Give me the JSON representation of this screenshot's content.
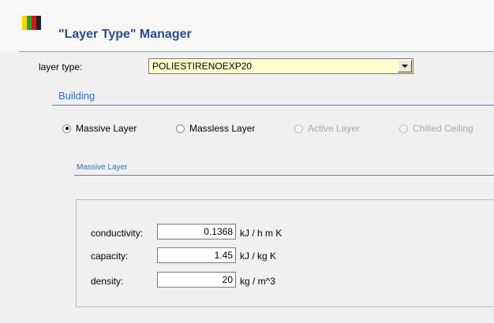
{
  "header": {
    "title": "\"Layer Type\" Manager",
    "logo_colors": [
      "#ffd400",
      "#2aa02a",
      "#d01818",
      "#222222"
    ]
  },
  "layer_type": {
    "label": "layer type:",
    "selected": "POLIESTIRENOEXP20"
  },
  "building": {
    "title": "Building",
    "options": [
      {
        "label": "Massive Layer",
        "checked": true,
        "enabled": true
      },
      {
        "label": "Massless Layer",
        "checked": false,
        "enabled": true
      },
      {
        "label": "Active Layer",
        "checked": false,
        "enabled": false
      },
      {
        "label": "Chilled Ceiling",
        "checked": false,
        "enabled": false
      }
    ]
  },
  "massive_layer": {
    "title": "Massive Layer",
    "fields": [
      {
        "label": "conductivity:",
        "value": "0.1368",
        "unit": "kJ / h m K"
      },
      {
        "label": "capacity:",
        "value": "1.45",
        "unit": "kJ / kg K"
      },
      {
        "label": "density:",
        "value": "20",
        "unit": "kg / m^3"
      }
    ]
  }
}
